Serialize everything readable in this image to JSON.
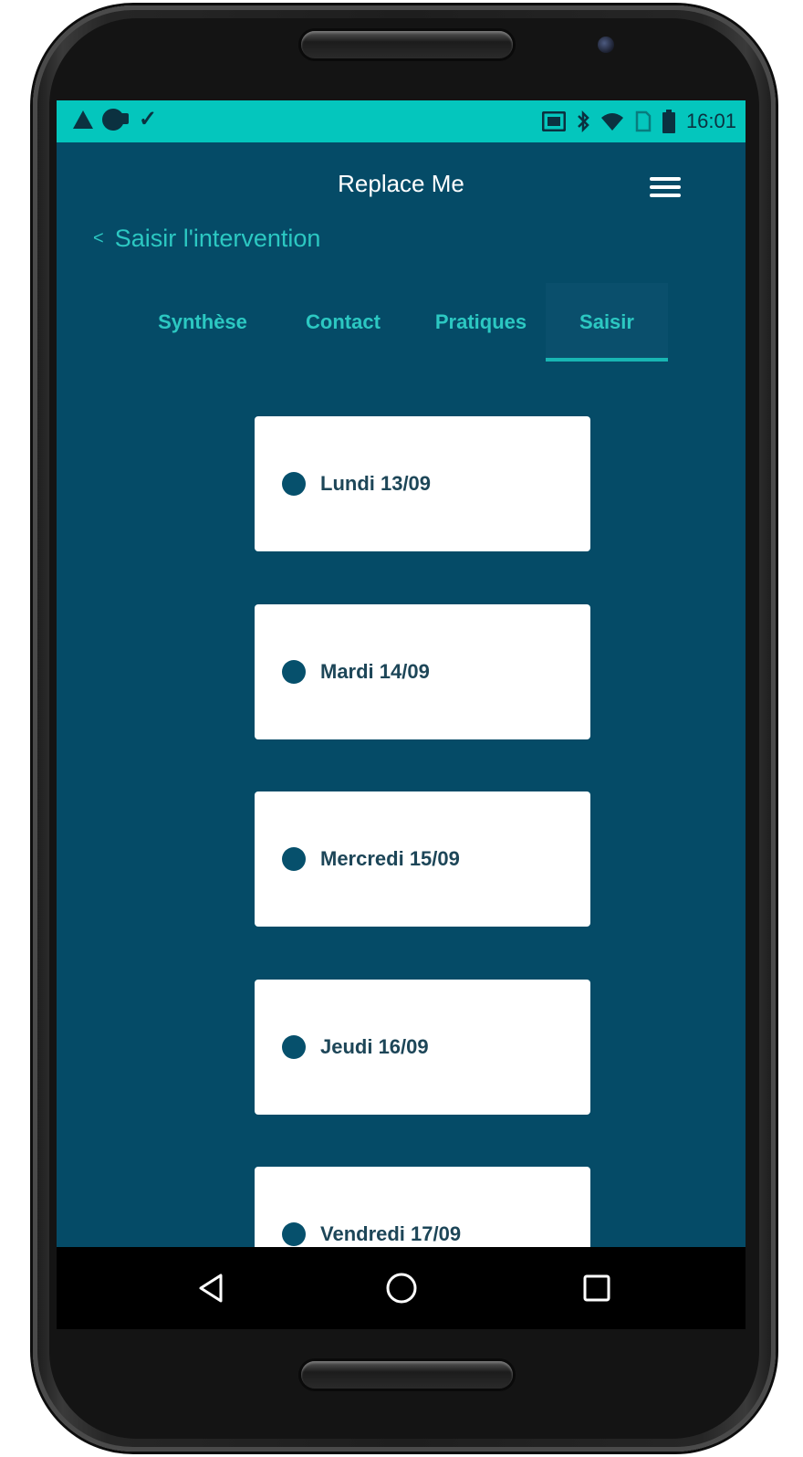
{
  "status_bar": {
    "time": "16:01",
    "left_icons": [
      "warning-icon",
      "hangouts-icon",
      "download-done-icon"
    ],
    "right_icons": [
      "cast-icon",
      "bluetooth-icon",
      "wifi-icon",
      "no-sim-icon",
      "battery-icon"
    ]
  },
  "app_bar": {
    "title": "Replace Me",
    "menu_icon": "hamburger-menu-icon"
  },
  "back_nav": {
    "chevron": "<",
    "label": "Saisir l'intervention"
  },
  "tabs": [
    {
      "label": "Synthèse",
      "active": false
    },
    {
      "label": "Contact",
      "active": false
    },
    {
      "label": "Pratiques",
      "active": false
    },
    {
      "label": "Saisir",
      "active": true
    }
  ],
  "days": [
    {
      "label": "Lundi 13/09"
    },
    {
      "label": "Mardi 14/09"
    },
    {
      "label": "Mercredi 15/09"
    },
    {
      "label": "Jeudi 16/09"
    },
    {
      "label": "Vendredi 17/09"
    }
  ],
  "nav_bar": {
    "buttons": [
      "back-triangle-icon",
      "home-circle-icon",
      "recents-square-icon"
    ]
  },
  "colors": {
    "status_bar": "#04c6bd",
    "background": "#054b67",
    "accent": "#2cc8c2",
    "card": "#ffffff",
    "dot": "#06506c"
  }
}
